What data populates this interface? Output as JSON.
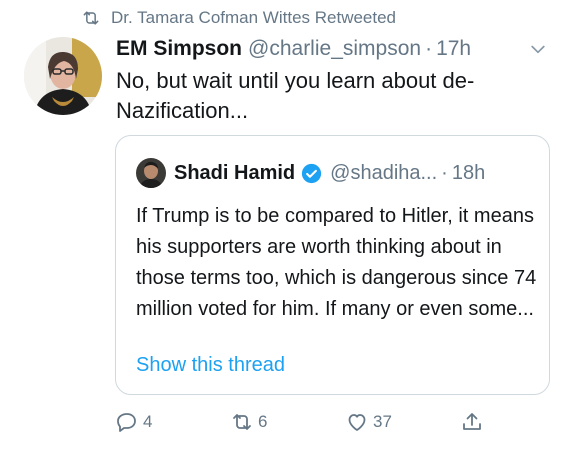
{
  "retweet": {
    "text": "Dr. Tamara Cofman Wittes Retweeted",
    "icon": "retweet-icon"
  },
  "tweet": {
    "name": "EM Simpson",
    "handle": "@charlie_simpson",
    "separator": "·",
    "time": "17h",
    "text": "No, but wait until you learn about de-Nazification..."
  },
  "quote": {
    "name": "Shadi Hamid",
    "handle": "@shadiha...",
    "separator": "·",
    "time": "18h",
    "text": "If Trump is to be compared to Hitler, it means his supporters are worth thinking about in those terms too, which is dangerous since 74 million voted for him. If many or even some...",
    "show_thread": "Show this thread"
  },
  "actions": {
    "reply_count": "4",
    "retweet_count": "6",
    "like_count": "37"
  },
  "colors": {
    "accent": "#1da1f2",
    "muted": "#657786",
    "text": "#14171a",
    "border": "#cfd9de"
  }
}
